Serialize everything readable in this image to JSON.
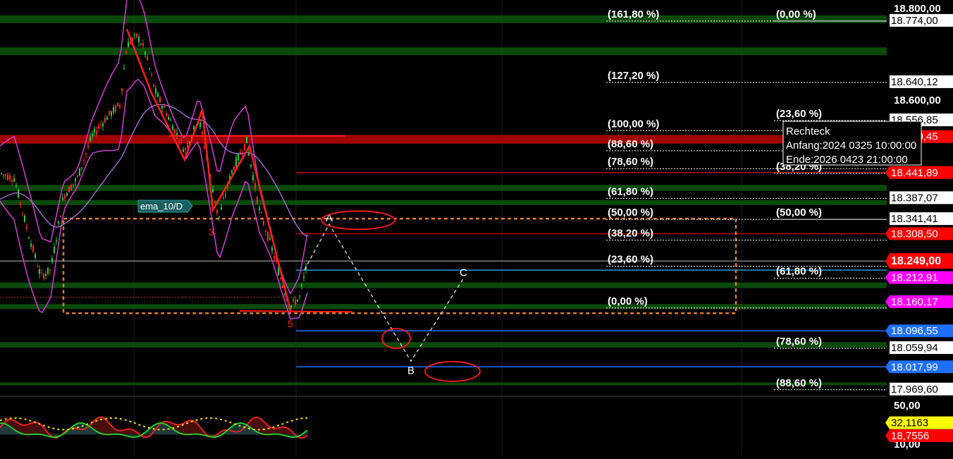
{
  "colors": {
    "background": "#000000",
    "green_zone": "#0b4d0b",
    "red_zone": "#8b0000",
    "candle_up": "#2ecc40",
    "candle_down": "#ff2a2a",
    "bollinger": "#d040d0",
    "ema": "#b070e0",
    "fib_line": "#ffffff",
    "rect_dashed": "#e07a2a",
    "label_red": "#ff0000",
    "label_blue": "#1f6fff",
    "label_magenta": "#ff00ff",
    "label_yellow": "#ffff00"
  },
  "chart_data": [
    {
      "type": "line",
      "title": "",
      "price_axis": {
        "range": [
          17940,
          18810
        ],
        "ticks": [
          "18.800,00",
          "18.600,00"
        ]
      },
      "price_labels": [
        {
          "text": "18.774,00",
          "value": 18774.0,
          "style": "white"
        },
        {
          "text": "18.640,12",
          "value": 18640.12,
          "style": "white"
        },
        {
          "text": "18.556,85",
          "value": 18556.85,
          "style": "white"
        },
        {
          "text": "18.520,45",
          "value": 18520.45,
          "style": "red"
        },
        {
          "text": "18.441,89",
          "value": 18441.89,
          "style": "red"
        },
        {
          "text": "18.387,07",
          "value": 18387.07,
          "style": "white"
        },
        {
          "text": "18.341,41",
          "value": 18341.41,
          "style": "white"
        },
        {
          "text": "18.308,50",
          "value": 18308.5,
          "style": "red"
        },
        {
          "text": "18.249,00",
          "value": 18249.0,
          "style": "current"
        },
        {
          "text": "18.212,91",
          "value": 18212.91,
          "style": "magenta"
        },
        {
          "text": "18.160,17",
          "value": 18160.17,
          "style": "magenta"
        },
        {
          "text": "18.096,55",
          "value": 18096.55,
          "style": "blue"
        },
        {
          "text": "18.059,94",
          "value": 18059.94,
          "style": "white"
        },
        {
          "text": "18.017,99",
          "value": 18017.99,
          "style": "blue"
        },
        {
          "text": "17.969,60",
          "value": 17969.6,
          "style": "white"
        }
      ],
      "fib_left": [
        {
          "label": "(161,80 %)",
          "value": 18774.0
        },
        {
          "label": "(127,20 %)",
          "value": 18640.12
        },
        {
          "label": "(100,00 %)",
          "value": 18535.0
        },
        {
          "label": "(88,60 %)",
          "value": 18491.0
        },
        {
          "label": "(78,60 %)",
          "value": 18452.0
        },
        {
          "label": "(61,80 %)",
          "value": 18387.07
        },
        {
          "label": "(50,00 %)",
          "value": 18341.41
        },
        {
          "label": "(38,20 %)",
          "value": 18296.0
        },
        {
          "label": "(23,60 %)",
          "value": 18239.0
        },
        {
          "label": "(0,00 %)",
          "value": 18148.0
        }
      ],
      "fib_right": [
        {
          "label": "(0,00 %)",
          "value": 18774.0
        },
        {
          "label": "(23,60 %)",
          "value": 18556.85
        },
        {
          "label": "(38,20 %)",
          "value": 18441.89
        },
        {
          "label": "(50,00 %)",
          "value": 18341.41
        },
        {
          "label": "(61,80 %)",
          "value": 18212.91
        },
        {
          "label": "(78,60 %)",
          "value": 18059.94
        },
        {
          "label": "(88,60 %)",
          "value": 17969.6
        }
      ],
      "abc_pattern": [
        {
          "label": "A",
          "value": 18341.41
        },
        {
          "label": "B",
          "value": 18017.99
        },
        {
          "label": "C",
          "value": 18212.91
        }
      ],
      "wave_labels": [
        "3",
        "5"
      ],
      "indicator_tag": "ema_10/D",
      "tooltip": {
        "title": "Rechteck",
        "start": "Anfang:2024 0325 10:00:00",
        "end": "Ende:2026 0423 21:00:00"
      }
    },
    {
      "type": "line",
      "title": "",
      "axis_ticks": [
        "50,00",
        "10,00"
      ],
      "value_labels": [
        {
          "text": "32,1163",
          "value": 32.1163,
          "style": "yellow"
        },
        {
          "text": "18,7556",
          "value": 18.7556,
          "style": "red"
        }
      ]
    }
  ]
}
